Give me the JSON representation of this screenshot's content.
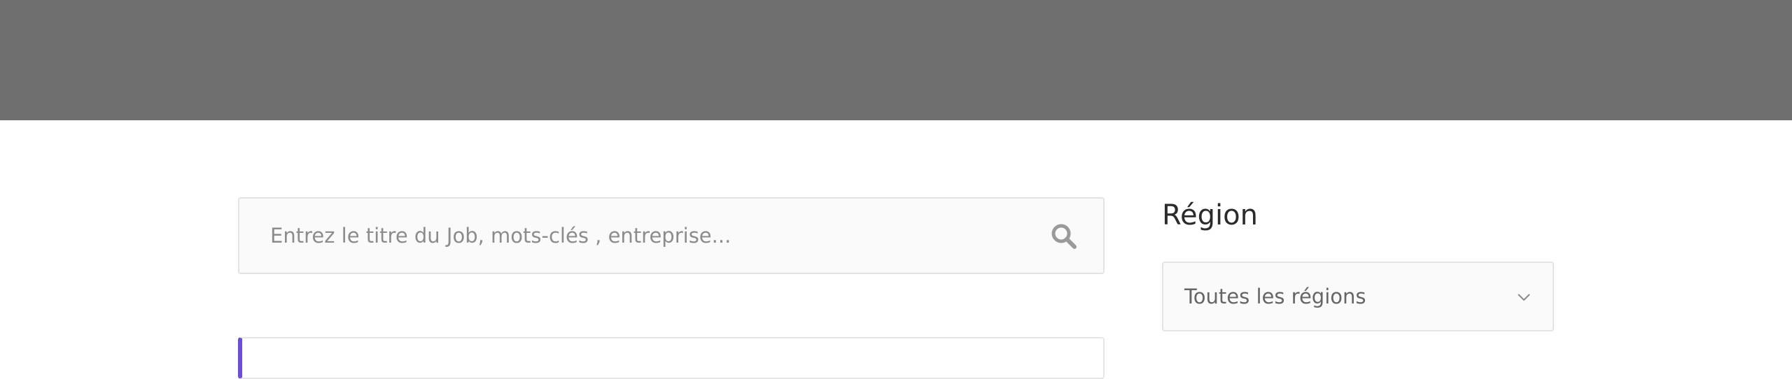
{
  "search": {
    "placeholder": "Entrez le titre du Job, mots-clés , entreprise...",
    "icon": "search-icon"
  },
  "region": {
    "title": "Région",
    "selected": "Toutes les régions",
    "icon": "chevron-down-icon"
  },
  "colors": {
    "banner": "#6f6f6f",
    "accent": "#6a4de0"
  }
}
